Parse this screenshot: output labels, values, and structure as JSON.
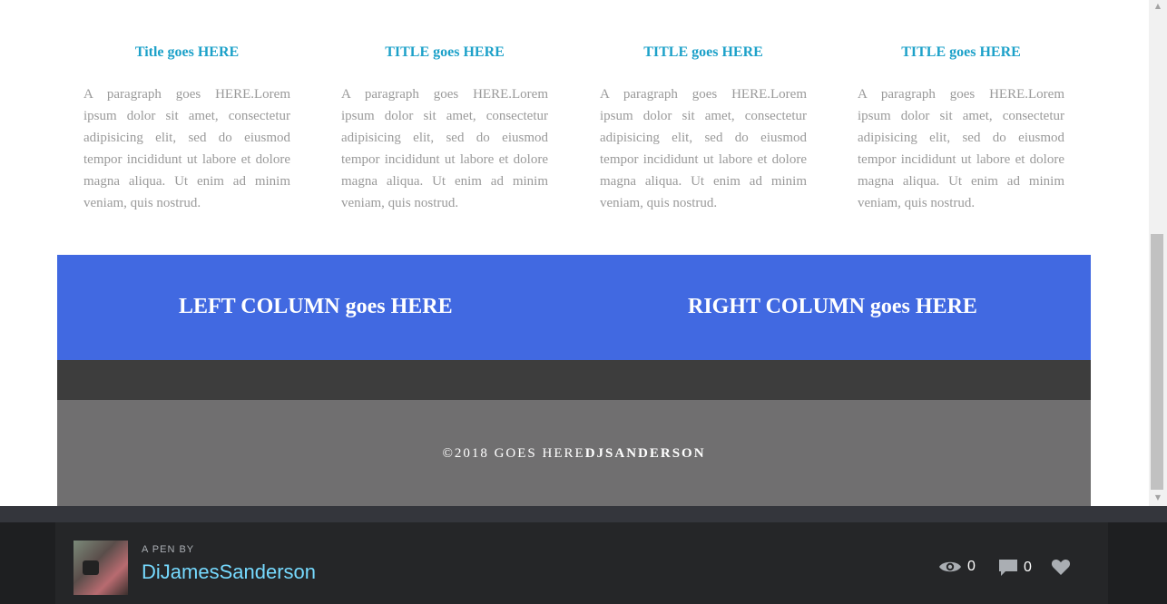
{
  "columns": [
    {
      "title": "Title goes HERE",
      "text": "A paragraph goes HERE.Lorem ipsum dolor sit amet, consectetur adipisicing elit, sed do eiusmod tempor incididunt ut labore et dolore magna aliqua. Ut enim ad minim veniam, quis nostrud."
    },
    {
      "title": "TITLE goes HERE",
      "text": "A paragraph goes HERE.Lorem ipsum dolor sit amet, consectetur adipisicing elit, sed do eiusmod tempor incididunt ut labore et dolore magna aliqua. Ut enim ad minim veniam, quis nostrud."
    },
    {
      "title": "TITLE goes HERE",
      "text": "A paragraph goes HERE.Lorem ipsum dolor sit amet, consectetur adipisicing elit, sed do eiusmod tempor incididunt ut labore et dolore magna aliqua. Ut enim ad minim veniam, quis nostrud."
    },
    {
      "title": "TITLE goes HERE",
      "text": "A paragraph goes HERE.Lorem ipsum dolor sit amet, consectetur adipisicing elit, sed do eiusmod tempor incididunt ut labore et dolore magna aliqua. Ut enim ad minim veniam, quis nostrud."
    }
  ],
  "band": {
    "left": "LEFT COLUMN goes HERE",
    "right": "RIGHT COLUMN goes HERE"
  },
  "footer": {
    "copyright": "©2018 GOES HERE",
    "author": "DJSANDERSON"
  },
  "codepen": {
    "pen_by": "A PEN BY",
    "author": "DiJamesSanderson",
    "views": "0",
    "comments": "0"
  },
  "colors": {
    "title": "#1da1c9",
    "band": "#4169e1",
    "footer": "#706f70",
    "author_link": "#76daff"
  },
  "icons": [
    "eye-icon",
    "comment-icon",
    "heart-icon",
    "scroll-up-arrow-icon",
    "scroll-down-arrow-icon"
  ]
}
